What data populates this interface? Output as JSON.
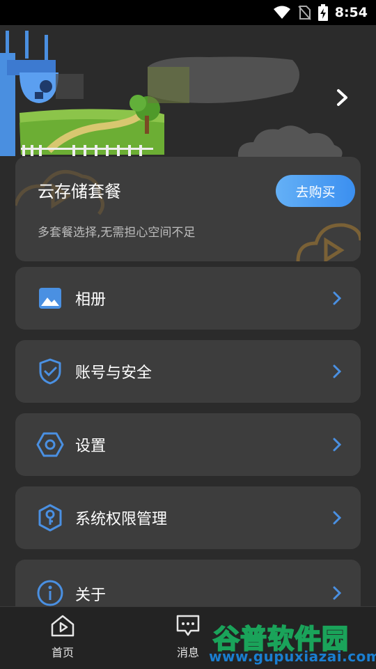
{
  "status": {
    "time": "8:54"
  },
  "cloud": {
    "title": "云存储套餐",
    "subtitle": "多套餐选择,无需担心空间不足",
    "buy_label": "去购买"
  },
  "menu": [
    {
      "label": "相册",
      "icon": "photo-icon"
    },
    {
      "label": "账号与安全",
      "icon": "shield-check-icon"
    },
    {
      "label": "设置",
      "icon": "hexagon-settings-icon"
    },
    {
      "label": "系统权限管理",
      "icon": "key-hexagon-icon"
    },
    {
      "label": "关于",
      "icon": "info-icon"
    }
  ],
  "nav": [
    {
      "label": "首页",
      "icon": "home-icon"
    },
    {
      "label": "消息",
      "icon": "message-icon"
    }
  ],
  "watermark": {
    "title": "谷普软件园",
    "url": "www.gupuxiazai.com"
  },
  "colors": {
    "accent": "#4a90e2",
    "card": "#3d3d3d",
    "background": "#2b2b2b"
  }
}
